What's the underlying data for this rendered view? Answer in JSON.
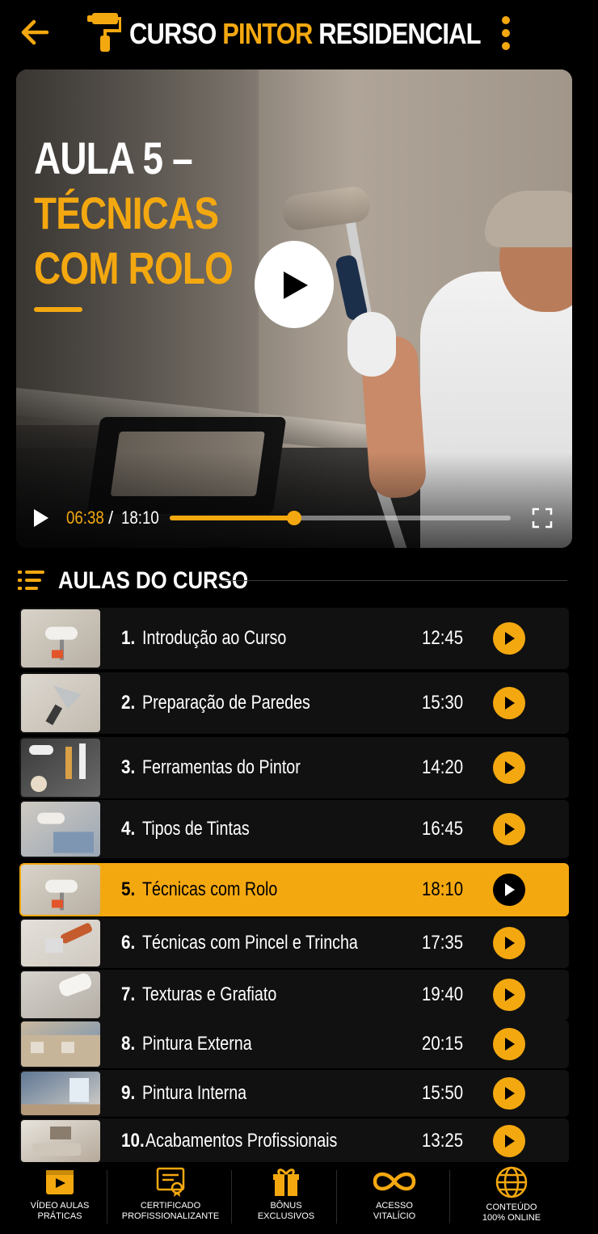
{
  "app": {
    "title_part1": "CURSO",
    "title_part2": "PINTOR",
    "title_part3": "RESIDENCIAL"
  },
  "colors": {
    "accent": "#f4a810",
    "background": "#000000",
    "row": "#111111"
  },
  "video": {
    "heading_line1": "AULA 5 –",
    "heading_line2": "TÉCNICAS",
    "heading_line3": "COM ROLO",
    "current_time": "06:38",
    "separator": "/",
    "total_time": "18:10",
    "progress_fraction": 0.365
  },
  "section": {
    "title": "AULAS DO CURSO"
  },
  "lessons": [
    {
      "num": "1.",
      "title": "Introdução ao Curso",
      "duration": "12:45",
      "thumb": "roller-on-wall",
      "active": false
    },
    {
      "num": "2.",
      "title": "Preparação de Paredes",
      "duration": "15:30",
      "thumb": "putty-knife",
      "active": false
    },
    {
      "num": "3.",
      "title": "Ferramentas do Pintor",
      "duration": "14:20",
      "thumb": "tools",
      "active": false
    },
    {
      "num": "4.",
      "title": "Tipos de Tintas",
      "duration": "16:45",
      "thumb": "paint-samples",
      "active": false
    },
    {
      "num": "5.",
      "title": "Técnicas com Rolo",
      "duration": "18:10",
      "thumb": "roller-on-wall",
      "active": true
    },
    {
      "num": "6.",
      "title": "Técnicas com Pincel e Trincha",
      "duration": "17:35",
      "thumb": "brush",
      "active": false
    },
    {
      "num": "7.",
      "title": "Texturas e Grafiato",
      "duration": "19:40",
      "thumb": "texture",
      "active": false
    },
    {
      "num": "8.",
      "title": "Pintura Externa",
      "duration": "20:15",
      "thumb": "house-exterior",
      "active": false
    },
    {
      "num": "9.",
      "title": "Pintura Interna",
      "duration": "15:50",
      "thumb": "interior-room",
      "active": false
    },
    {
      "num": "10.",
      "title": "Acabamentos Profissionais",
      "duration": "13:25",
      "thumb": "living-room",
      "active": false
    }
  ],
  "bottom_nav": [
    {
      "label": "VÍDEO AULAS\nPRÁTICAS",
      "icon": "video-icon"
    },
    {
      "label": "CERTIFICADO\nPROFISSIONALIZANTE",
      "icon": "certificate-icon"
    },
    {
      "label": "BÔNUS\nEXCLUSIVOS",
      "icon": "gift-icon"
    },
    {
      "label": "ACESSO\nVITALÍCIO",
      "icon": "infinity-icon"
    },
    {
      "label": "CONTEÚDO\n100% ONLINE",
      "icon": "globe-icon"
    }
  ]
}
